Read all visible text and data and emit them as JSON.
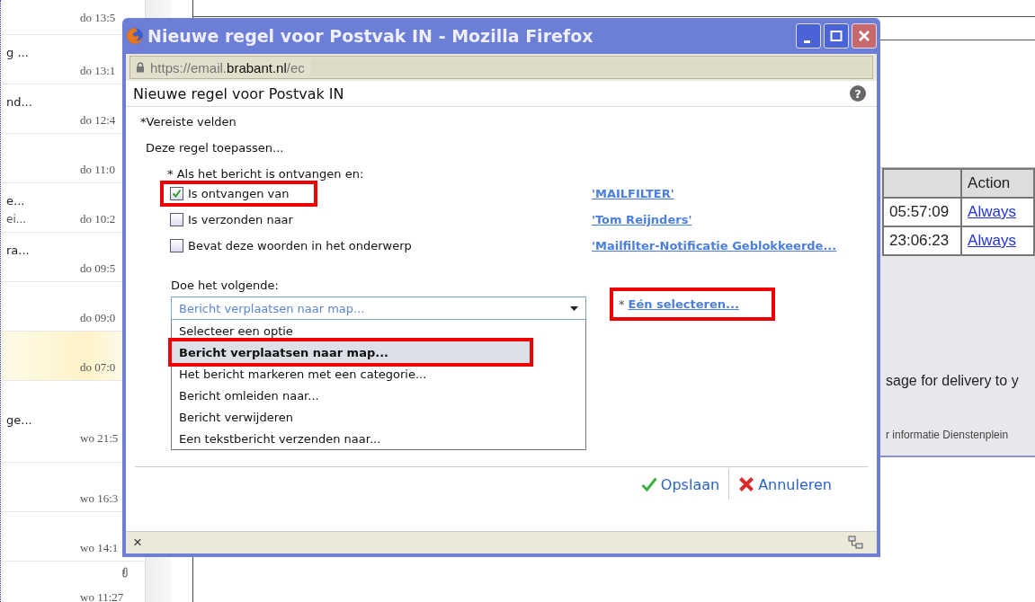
{
  "mail_list": [
    {
      "date": "do 13:5"
    },
    {
      "subject": "g ...",
      "date": "do 13:1"
    },
    {
      "subject": "nd...",
      "date": "do 12:4"
    },
    {
      "date": "do 11:0"
    },
    {
      "subject": "e...",
      "preview": "ei...",
      "date": "do 10:2"
    },
    {
      "subject": "ra...",
      "date": "do 09:5"
    },
    {
      "date": "do 09:0"
    },
    {
      "date": "do 07:0",
      "selected": true
    },
    {
      "subject": "ge...",
      "date": "wo 21:5",
      "selected": false
    },
    {
      "date": "wo 16:3"
    },
    {
      "date": "wo 14:1"
    },
    {
      "date": "wo 11:27",
      "attachment": true
    }
  ],
  "background_page": {
    "table": {
      "columns": [
        "Action"
      ],
      "rows": [
        {
          "time": "05:57:09",
          "action": "Always"
        },
        {
          "time": "23:06:23",
          "action": "Always"
        }
      ]
    },
    "message": "sage for delivery to y",
    "footer": "r informatie Dienstenplein"
  },
  "dialog": {
    "title": "Nieuwe regel voor Postvak IN - Mozilla Firefox",
    "url_start": "https://email.",
    "url_domain": "brabant.nl",
    "url_end": "/ec",
    "heading": "Nieuwe regel voor Postvak IN",
    "help_label": "?",
    "required_note": "*Vereiste velden",
    "intro": "Deze regel toepassen...",
    "conditions_label": "* Als het bericht is ontvangen en:",
    "conditions": [
      {
        "label": "Is ontvangen van",
        "checked": true,
        "highlighted": true,
        "value": "'MAILFILTER'"
      },
      {
        "label": "Is verzonden naar",
        "checked": false,
        "highlighted": false,
        "value": "'Tom Reijnders'"
      },
      {
        "label": "Bevat deze woorden in het onderwerp",
        "checked": false,
        "highlighted": false,
        "value": "'Mailfilter-Notificatie Geblokkeerde..."
      }
    ],
    "action_label": "Doe het volgende:",
    "action_select": {
      "value": "Bericht verplaatsen naar map...",
      "expanded": true,
      "options": [
        {
          "label": "Selecteer een optie",
          "selected": false
        },
        {
          "label": "Bericht verplaatsen naar map...",
          "selected": true
        },
        {
          "label": "Het bericht markeren met een categorie...",
          "selected": false
        },
        {
          "label": "Bericht omleiden naar...",
          "selected": false
        },
        {
          "label": "Bericht verwijderen",
          "selected": false
        },
        {
          "label": "Een tekstbericht verzenden naar...",
          "selected": false
        }
      ]
    },
    "target": {
      "required_mark": "*",
      "link": "Eén selecteren...",
      "highlighted": true
    },
    "buttons": [
      {
        "kind": "save",
        "label": "Opslaan"
      },
      {
        "kind": "cancel",
        "label": "Annuleren"
      }
    ],
    "status_close": "×"
  }
}
